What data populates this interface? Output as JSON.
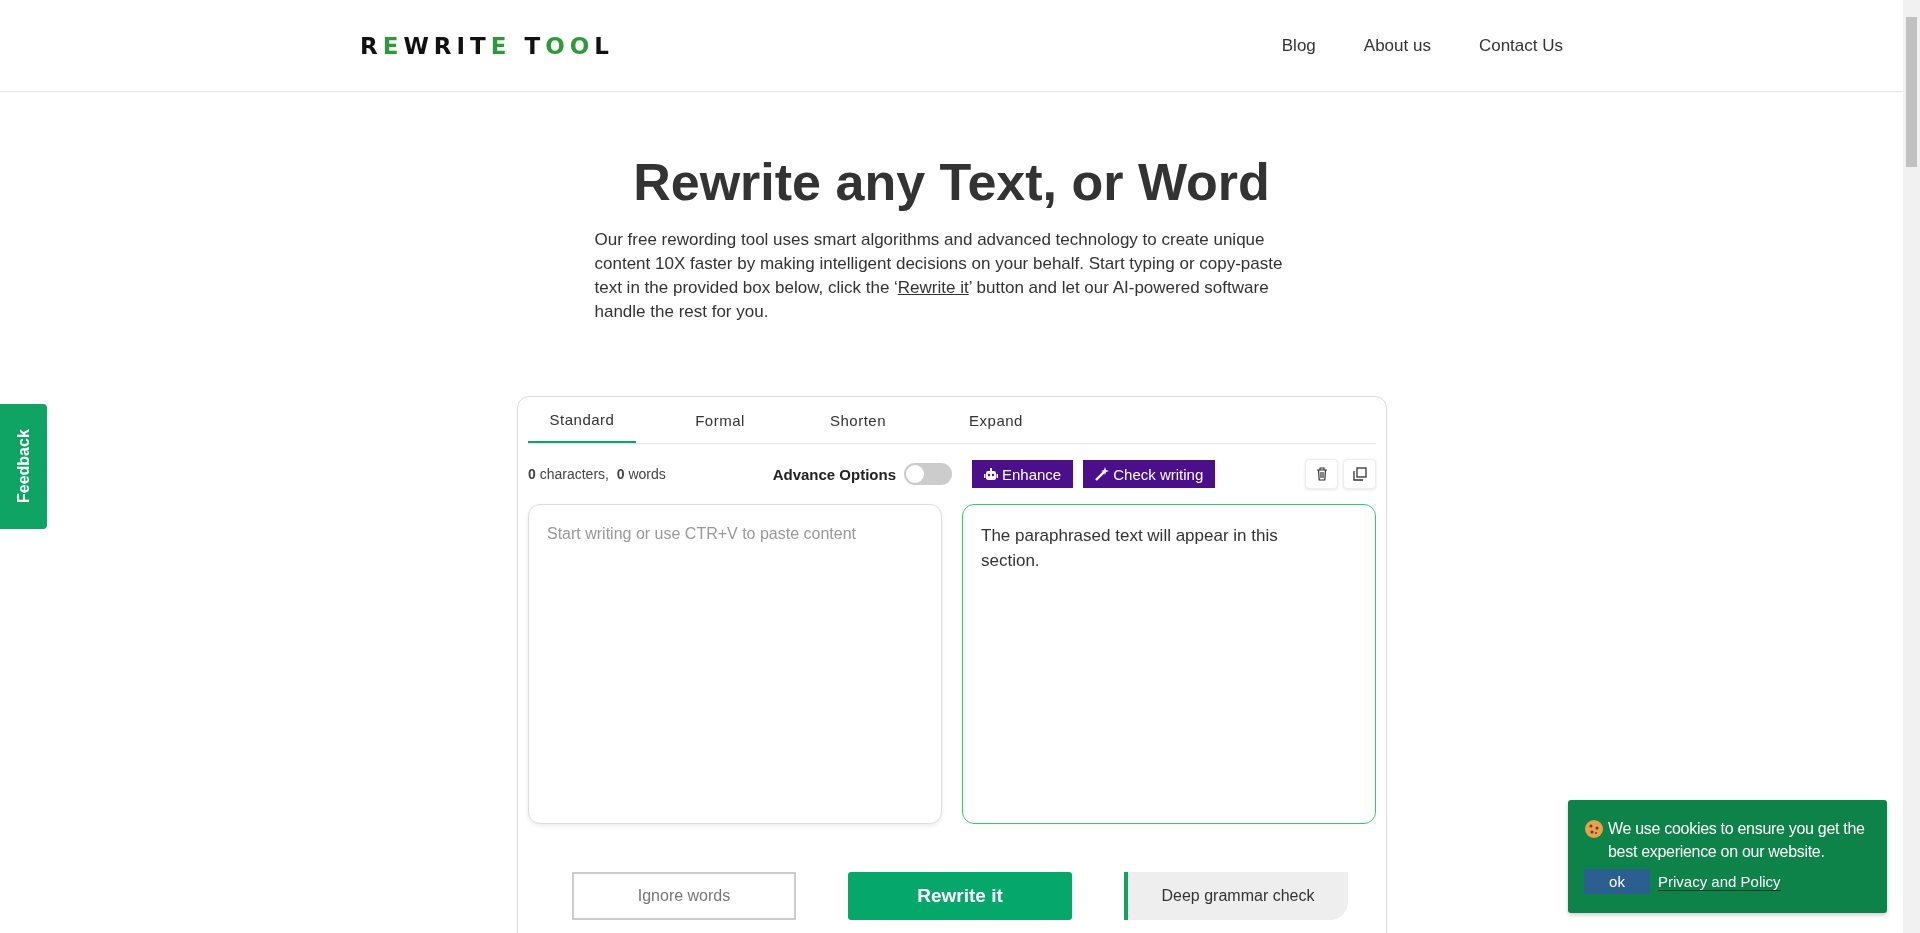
{
  "header": {
    "logo": [
      {
        "text": "R",
        "accent": false
      },
      {
        "text": "E",
        "accent": true
      },
      {
        "text": "WRIT",
        "accent": false
      },
      {
        "text": "E",
        "accent": true
      },
      {
        "text": " T",
        "accent": false
      },
      {
        "text": "OO",
        "accent": true
      },
      {
        "text": "L",
        "accent": false
      }
    ],
    "nav": [
      "Blog",
      "About us",
      "Contact Us"
    ]
  },
  "feedback": "Feedback",
  "hero": {
    "title": "Rewrite any Text, or Word",
    "intro_before": "Our free rewording tool uses smart algorithms and advanced technology to create unique content 10X faster by making intelligent decisions on your behalf. Start typing or copy-paste text in the provided box below, click the ‘",
    "intro_link": "Rewrite it",
    "intro_after": "’ button and let our AI-powered software handle the rest for you."
  },
  "tool": {
    "tabs": [
      {
        "label": "Standard",
        "selected": true
      },
      {
        "label": "Formal",
        "selected": false
      },
      {
        "label": "Shorten",
        "selected": false
      },
      {
        "label": "Expand",
        "selected": false
      }
    ],
    "char_count": "0",
    "char_label": "characters,",
    "word_count": "0",
    "word_label": "words",
    "advance_options": {
      "label": "Advance Options",
      "on": false
    },
    "enhance": "Enhance",
    "check_writing": "Check writing",
    "input_placeholder": "Start writing or use CTR+V to paste content",
    "output": "The paraphrased text will appear in this section.",
    "ignore_words": "Ignore words",
    "rewrite": "Rewrite it",
    "deep_check": "Deep grammar check"
  },
  "cookie": {
    "message": "We use cookies to ensure you get the best experience on our website.",
    "ok": "ok",
    "policy": "Privacy and Policy"
  }
}
